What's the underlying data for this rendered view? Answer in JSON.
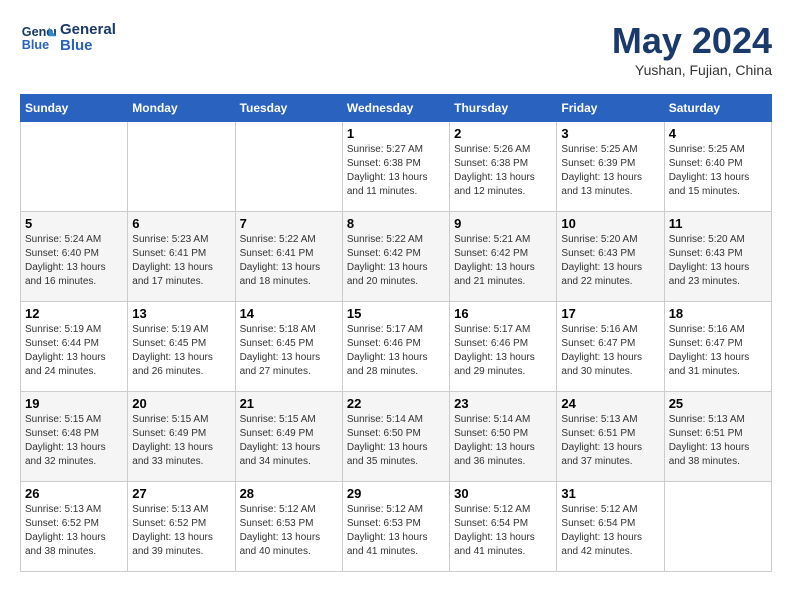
{
  "header": {
    "logo_line1": "General",
    "logo_line2": "Blue",
    "month": "May 2024",
    "location": "Yushan, Fujian, China"
  },
  "weekdays": [
    "Sunday",
    "Monday",
    "Tuesday",
    "Wednesday",
    "Thursday",
    "Friday",
    "Saturday"
  ],
  "weeks": [
    [
      {
        "day": "",
        "info": ""
      },
      {
        "day": "",
        "info": ""
      },
      {
        "day": "",
        "info": ""
      },
      {
        "day": "1",
        "info": "Sunrise: 5:27 AM\nSunset: 6:38 PM\nDaylight: 13 hours and 11 minutes."
      },
      {
        "day": "2",
        "info": "Sunrise: 5:26 AM\nSunset: 6:38 PM\nDaylight: 13 hours and 12 minutes."
      },
      {
        "day": "3",
        "info": "Sunrise: 5:25 AM\nSunset: 6:39 PM\nDaylight: 13 hours and 13 minutes."
      },
      {
        "day": "4",
        "info": "Sunrise: 5:25 AM\nSunset: 6:40 PM\nDaylight: 13 hours and 15 minutes."
      }
    ],
    [
      {
        "day": "5",
        "info": "Sunrise: 5:24 AM\nSunset: 6:40 PM\nDaylight: 13 hours and 16 minutes."
      },
      {
        "day": "6",
        "info": "Sunrise: 5:23 AM\nSunset: 6:41 PM\nDaylight: 13 hours and 17 minutes."
      },
      {
        "day": "7",
        "info": "Sunrise: 5:22 AM\nSunset: 6:41 PM\nDaylight: 13 hours and 18 minutes."
      },
      {
        "day": "8",
        "info": "Sunrise: 5:22 AM\nSunset: 6:42 PM\nDaylight: 13 hours and 20 minutes."
      },
      {
        "day": "9",
        "info": "Sunrise: 5:21 AM\nSunset: 6:42 PM\nDaylight: 13 hours and 21 minutes."
      },
      {
        "day": "10",
        "info": "Sunrise: 5:20 AM\nSunset: 6:43 PM\nDaylight: 13 hours and 22 minutes."
      },
      {
        "day": "11",
        "info": "Sunrise: 5:20 AM\nSunset: 6:43 PM\nDaylight: 13 hours and 23 minutes."
      }
    ],
    [
      {
        "day": "12",
        "info": "Sunrise: 5:19 AM\nSunset: 6:44 PM\nDaylight: 13 hours and 24 minutes."
      },
      {
        "day": "13",
        "info": "Sunrise: 5:19 AM\nSunset: 6:45 PM\nDaylight: 13 hours and 26 minutes."
      },
      {
        "day": "14",
        "info": "Sunrise: 5:18 AM\nSunset: 6:45 PM\nDaylight: 13 hours and 27 minutes."
      },
      {
        "day": "15",
        "info": "Sunrise: 5:17 AM\nSunset: 6:46 PM\nDaylight: 13 hours and 28 minutes."
      },
      {
        "day": "16",
        "info": "Sunrise: 5:17 AM\nSunset: 6:46 PM\nDaylight: 13 hours and 29 minutes."
      },
      {
        "day": "17",
        "info": "Sunrise: 5:16 AM\nSunset: 6:47 PM\nDaylight: 13 hours and 30 minutes."
      },
      {
        "day": "18",
        "info": "Sunrise: 5:16 AM\nSunset: 6:47 PM\nDaylight: 13 hours and 31 minutes."
      }
    ],
    [
      {
        "day": "19",
        "info": "Sunrise: 5:15 AM\nSunset: 6:48 PM\nDaylight: 13 hours and 32 minutes."
      },
      {
        "day": "20",
        "info": "Sunrise: 5:15 AM\nSunset: 6:49 PM\nDaylight: 13 hours and 33 minutes."
      },
      {
        "day": "21",
        "info": "Sunrise: 5:15 AM\nSunset: 6:49 PM\nDaylight: 13 hours and 34 minutes."
      },
      {
        "day": "22",
        "info": "Sunrise: 5:14 AM\nSunset: 6:50 PM\nDaylight: 13 hours and 35 minutes."
      },
      {
        "day": "23",
        "info": "Sunrise: 5:14 AM\nSunset: 6:50 PM\nDaylight: 13 hours and 36 minutes."
      },
      {
        "day": "24",
        "info": "Sunrise: 5:13 AM\nSunset: 6:51 PM\nDaylight: 13 hours and 37 minutes."
      },
      {
        "day": "25",
        "info": "Sunrise: 5:13 AM\nSunset: 6:51 PM\nDaylight: 13 hours and 38 minutes."
      }
    ],
    [
      {
        "day": "26",
        "info": "Sunrise: 5:13 AM\nSunset: 6:52 PM\nDaylight: 13 hours and 38 minutes."
      },
      {
        "day": "27",
        "info": "Sunrise: 5:13 AM\nSunset: 6:52 PM\nDaylight: 13 hours and 39 minutes."
      },
      {
        "day": "28",
        "info": "Sunrise: 5:12 AM\nSunset: 6:53 PM\nDaylight: 13 hours and 40 minutes."
      },
      {
        "day": "29",
        "info": "Sunrise: 5:12 AM\nSunset: 6:53 PM\nDaylight: 13 hours and 41 minutes."
      },
      {
        "day": "30",
        "info": "Sunrise: 5:12 AM\nSunset: 6:54 PM\nDaylight: 13 hours and 41 minutes."
      },
      {
        "day": "31",
        "info": "Sunrise: 5:12 AM\nSunset: 6:54 PM\nDaylight: 13 hours and 42 minutes."
      },
      {
        "day": "",
        "info": ""
      }
    ]
  ]
}
